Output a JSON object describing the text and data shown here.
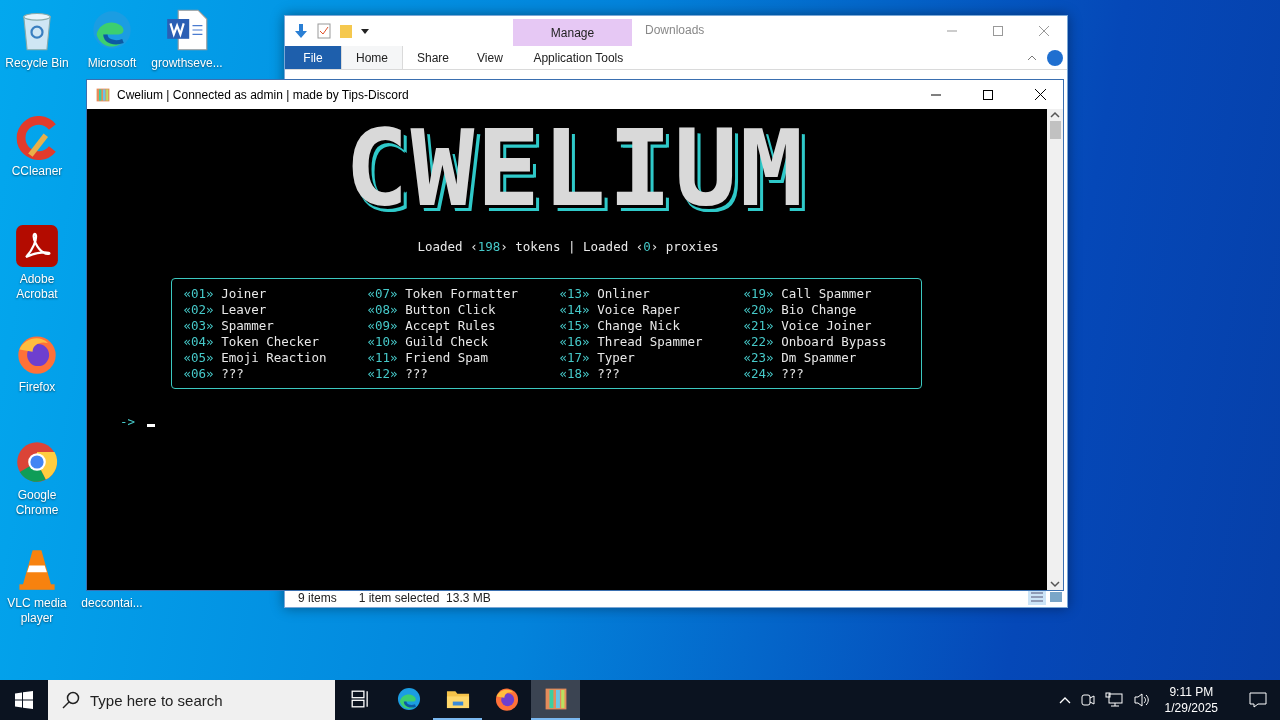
{
  "desktop_icons": [
    {
      "label": "Recycle Bin",
      "kind": "recycle"
    },
    {
      "label": "Microsoft",
      "kind": "edge"
    },
    {
      "label": "growthseve...",
      "kind": "word"
    },
    {
      "label": "CCleaner",
      "kind": "ccleaner"
    },
    {
      "label": "Adobe Acrobat",
      "kind": "acrobat"
    },
    {
      "label": "Firefox",
      "kind": "firefox"
    },
    {
      "label": "Google Chrome",
      "kind": "chrome"
    },
    {
      "label": "VLC media player",
      "kind": "vlc"
    },
    {
      "label": "deccontai...",
      "kind": "covered"
    }
  ],
  "explorer": {
    "title": "Downloads",
    "context_tab": "Manage",
    "tabs": [
      {
        "label": "File",
        "kind": "file",
        "selected": false
      },
      {
        "label": "Home",
        "kind": "tab",
        "selected": true
      },
      {
        "label": "Share",
        "kind": "tab",
        "selected": false
      },
      {
        "label": "View",
        "kind": "tab",
        "selected": false
      },
      {
        "label": "Application Tools",
        "kind": "context",
        "selected": false
      }
    ],
    "status": {
      "items": "9 items",
      "selection": "1 item selected  13.3 MB"
    }
  },
  "console": {
    "title": "Cwelium | Connected as admin | made by Tips-Discord",
    "banner": "CWELIUM",
    "status_line": [
      {
        "text": "Loaded ‹",
        "accent": false
      },
      {
        "text": "198",
        "accent": true
      },
      {
        "text": "› tokens | Loaded ‹",
        "accent": false
      },
      {
        "text": "0",
        "accent": true
      },
      {
        "text": "› proxies",
        "accent": false
      }
    ],
    "menu_columns": [
      [
        {
          "num": "«01»",
          "label": "Joiner"
        },
        {
          "num": "«02»",
          "label": "Leaver"
        },
        {
          "num": "«03»",
          "label": "Spammer"
        },
        {
          "num": "«04»",
          "label": "Token Checker"
        },
        {
          "num": "«05»",
          "label": "Emoji Reaction"
        },
        {
          "num": "«06»",
          "label": "???"
        }
      ],
      [
        {
          "num": "«07»",
          "label": "Token Formatter"
        },
        {
          "num": "«08»",
          "label": "Button Click"
        },
        {
          "num": "«09»",
          "label": "Accept Rules"
        },
        {
          "num": "«10»",
          "label": "Guild Check"
        },
        {
          "num": "«11»",
          "label": "Friend Spam"
        },
        {
          "num": "«12»",
          "label": "???"
        }
      ],
      [
        {
          "num": "«13»",
          "label": "Onliner"
        },
        {
          "num": "«14»",
          "label": "Voice Raper"
        },
        {
          "num": "«15»",
          "label": "Change Nick"
        },
        {
          "num": "«16»",
          "label": "Thread Spammer"
        },
        {
          "num": "«17»",
          "label": "Typer"
        },
        {
          "num": "«18»",
          "label": "???"
        }
      ],
      [
        {
          "num": "«19»",
          "label": "Call Spammer"
        },
        {
          "num": "«20»",
          "label": "Bio Change"
        },
        {
          "num": "«21»",
          "label": "Voice Joiner"
        },
        {
          "num": "«22»",
          "label": "Onboard Bypass"
        },
        {
          "num": "«23»",
          "label": "Dm Spammer"
        },
        {
          "num": "«24»",
          "label": "???"
        }
      ]
    ],
    "prompt": "->"
  },
  "taskbar": {
    "search_placeholder": "Type here to search",
    "apps": [
      {
        "kind": "taskview",
        "running": false,
        "selected": false
      },
      {
        "kind": "edge",
        "running": false,
        "selected": false
      },
      {
        "kind": "explorer",
        "running": true,
        "selected": false
      },
      {
        "kind": "firefox",
        "running": false,
        "selected": false
      },
      {
        "kind": "app",
        "running": true,
        "selected": true
      }
    ],
    "time": "9:11 PM",
    "date": "1/29/2025"
  }
}
